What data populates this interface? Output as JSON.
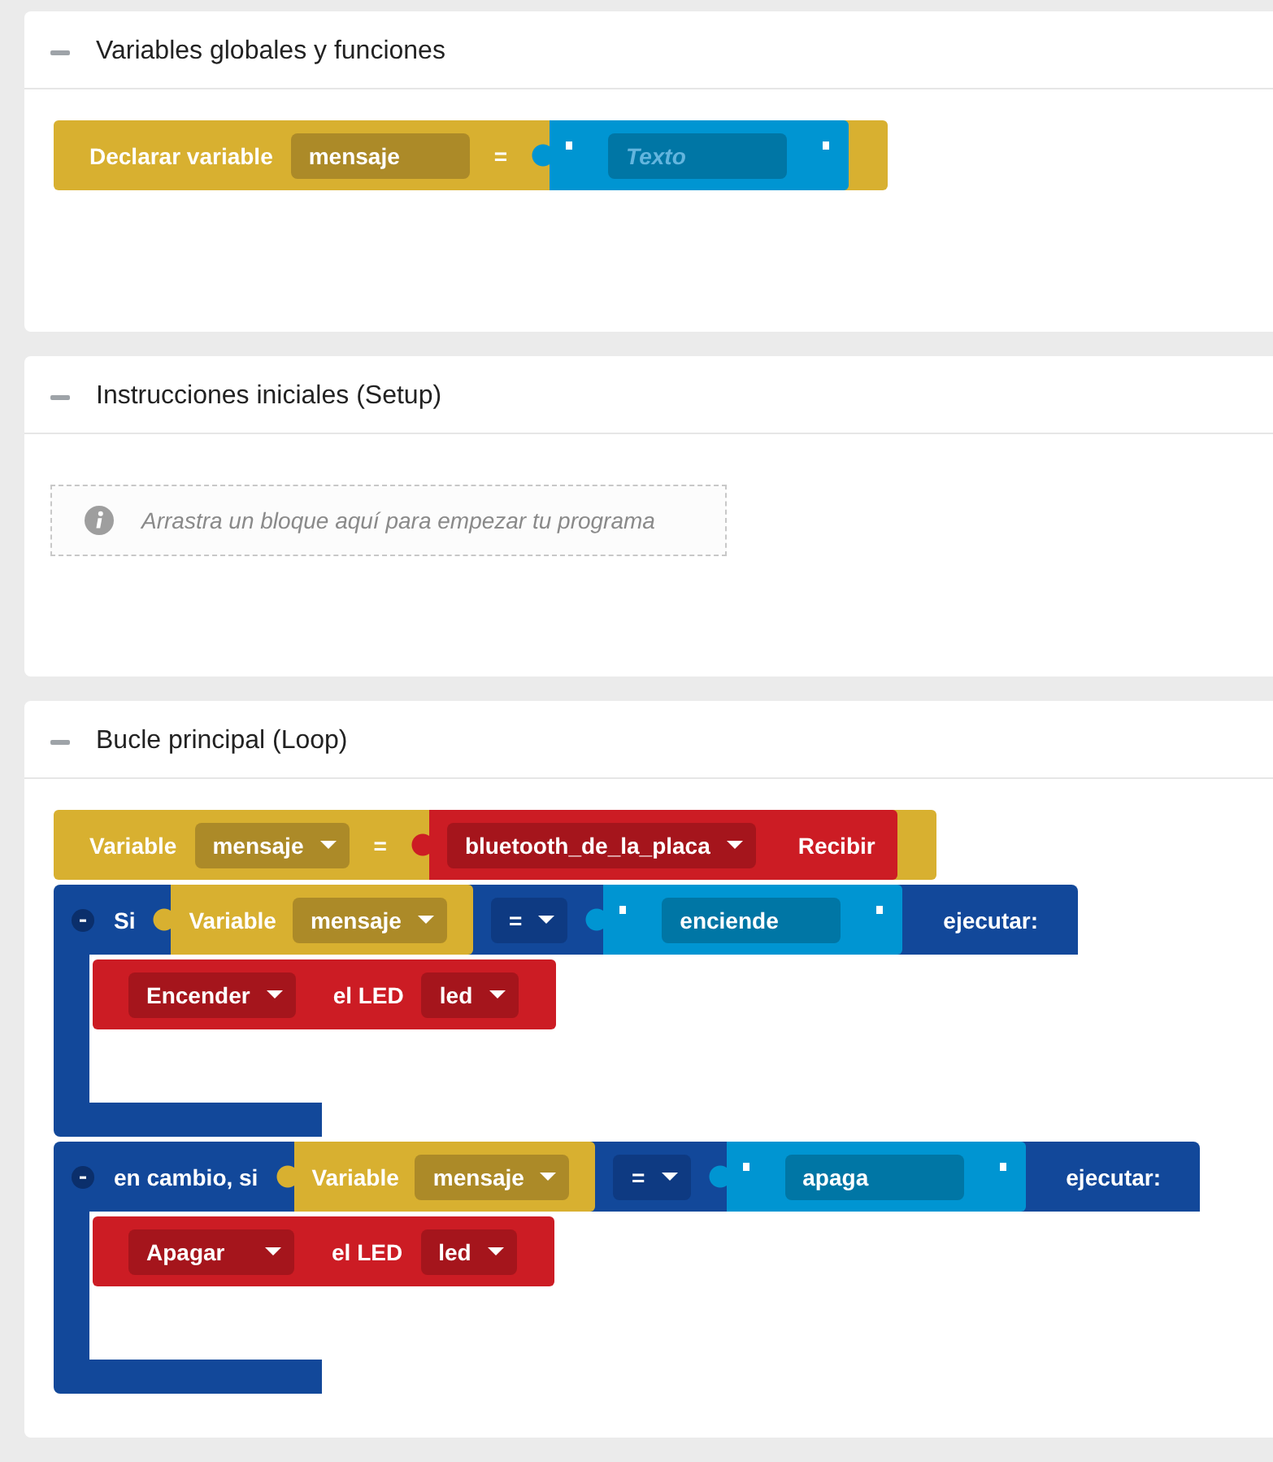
{
  "sections": [
    {
      "title": "Variables globales y funciones",
      "expanded": true,
      "blocks": [
        {
          "kind": "declare_variable",
          "label": "Declarar variable",
          "variable": "mensaje",
          "operator": "=",
          "value": {
            "kind": "text",
            "placeholder": "Texto"
          }
        }
      ]
    },
    {
      "title": "Instrucciones iniciales (Setup)",
      "expanded": true,
      "hint": "Arrastra un bloque aquí para empezar tu programa"
    },
    {
      "title": "Bucle principal (Loop)",
      "expanded": true,
      "blocks": [
        {
          "kind": "assign_variable",
          "label": "Variable",
          "variable": "mensaje",
          "operator": "=",
          "value": {
            "kind": "bluetooth_receive",
            "device": "bluetooth_de_la_placa",
            "label": "Recibir"
          }
        },
        {
          "kind": "if",
          "label": "Si",
          "condition": {
            "left": {
              "kind": "variable",
              "label": "Variable",
              "variable": "mensaje"
            },
            "operator": "=",
            "right": {
              "kind": "text",
              "value": "enciende"
            }
          },
          "then_label": "ejecutar:",
          "body": [
            {
              "kind": "led",
              "action": "Encender",
              "label": "el LED",
              "pin": "led"
            }
          ]
        },
        {
          "kind": "if",
          "label": "en cambio, si",
          "condition": {
            "left": {
              "kind": "variable",
              "label": "Variable",
              "variable": "mensaje"
            },
            "operator": "=",
            "right": {
              "kind": "text",
              "value": "apaga"
            }
          },
          "then_label": "ejecutar:",
          "body": [
            {
              "kind": "led",
              "action": "Apagar",
              "label": "el LED",
              "pin": "led"
            }
          ]
        }
      ]
    }
  ]
}
